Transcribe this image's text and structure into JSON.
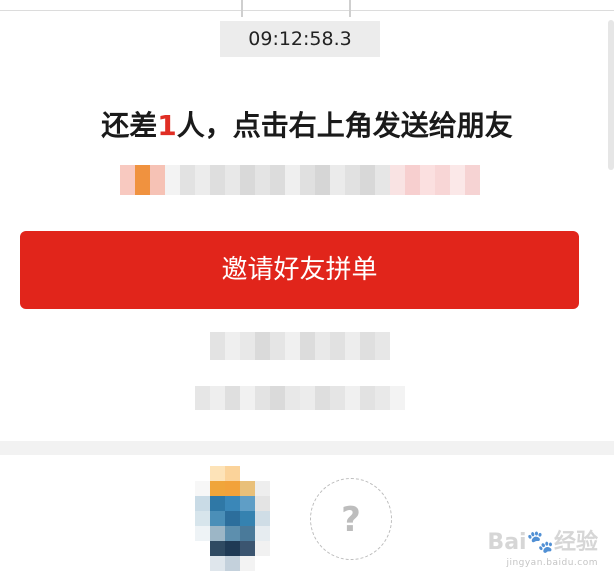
{
  "timer": {
    "text": "09:12:58.3"
  },
  "headline": {
    "prefix": "还差",
    "count": "1",
    "suffix": "人，点击右上角发送给朋友"
  },
  "invite_button": {
    "label": "邀请好友拼单"
  },
  "placeholder_avatar": {
    "symbol": "?"
  },
  "watermark": {
    "brand": "Bai",
    "brand_cn": "经验",
    "site": "jingyan.baidu.com"
  },
  "colors": {
    "accent": "#e1251b",
    "count_red": "#e02e24"
  },
  "icons": [
    "question-mark-icon",
    "baidu-paw-icon"
  ]
}
